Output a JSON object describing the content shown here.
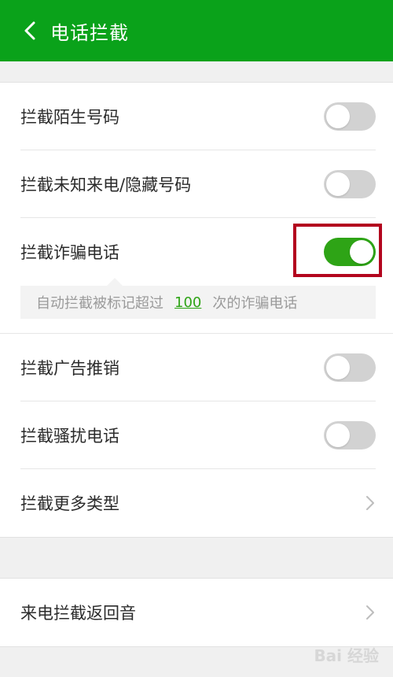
{
  "header": {
    "title": "电话拦截",
    "back_icon": "chevron-left-icon"
  },
  "section1": {
    "items": [
      {
        "label": "拦截陌生号码",
        "enabled": false
      },
      {
        "label": "拦截未知来电/隐藏号码",
        "enabled": false
      },
      {
        "label": "拦截诈骗电话",
        "enabled": true
      },
      {
        "label": "拦截广告推销",
        "enabled": false
      },
      {
        "label": "拦截骚扰电话",
        "enabled": false
      },
      {
        "label": "拦截更多类型"
      }
    ],
    "fraud_note": {
      "prefix": "自动拦截被标记超过",
      "count": "100",
      "suffix": "次的诈骗电话"
    }
  },
  "section2": {
    "items": [
      {
        "label": "来电拦截返回音"
      }
    ]
  },
  "watermark": {
    "text": "Bai 经验"
  },
  "colors": {
    "brand": "#0aa21a",
    "switch_on": "#2ea416",
    "highlight": "#b3051e"
  }
}
